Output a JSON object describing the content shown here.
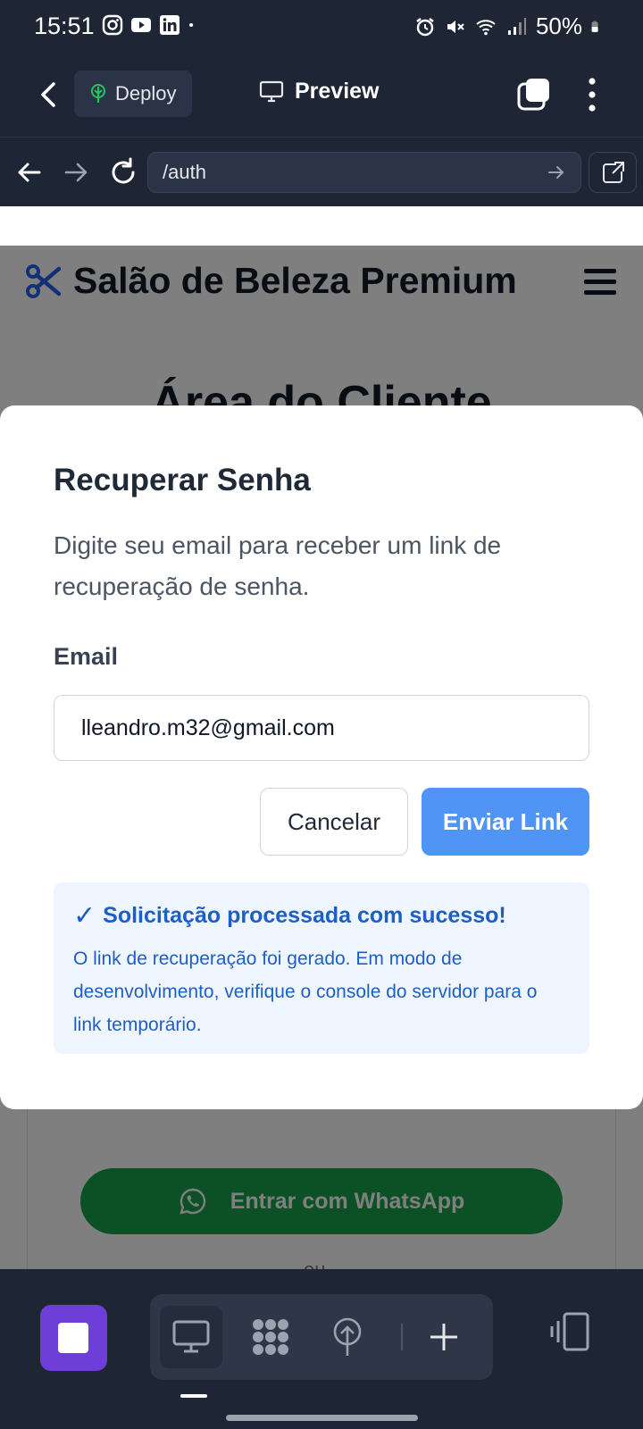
{
  "status_bar": {
    "time": "15:51",
    "battery": "50%",
    "left_icons": [
      "instagram-icon",
      "youtube-icon",
      "linkedin-icon",
      "dot-icon"
    ],
    "right_icons": [
      "alarm-icon",
      "mute-icon",
      "wifi-icon",
      "signal-icon",
      "battery-icon"
    ]
  },
  "app_toolbar": {
    "deploy_label": "Deploy",
    "preview_label": "Preview"
  },
  "url_bar": {
    "url": "/auth"
  },
  "site": {
    "title": "Salão de Beleza Premium",
    "area_title": "Área do Cliente",
    "whatsapp_button": "Entrar com WhatsApp",
    "or_text": "ou"
  },
  "modal": {
    "title": "Recuperar Senha",
    "description": "Digite seu email para receber um link de recuperação de senha.",
    "email_label": "Email",
    "email_value": "lleandro.m32@gmail.com",
    "cancel_label": "Cancelar",
    "send_label": "Enviar Link",
    "success_title": "Solicitação processada com sucesso!",
    "success_check": "✓",
    "success_body": "O link de recuperação foi gerado. Em modo de desenvolvimento, verifique o console do servidor para o link temporário."
  },
  "colors": {
    "primary_blue": "#5094f5",
    "success_text": "#1d5fc7",
    "whatsapp_green": "#16a34a",
    "app_purple": "#6d3ed8",
    "chrome_dark": "#1e2535"
  }
}
